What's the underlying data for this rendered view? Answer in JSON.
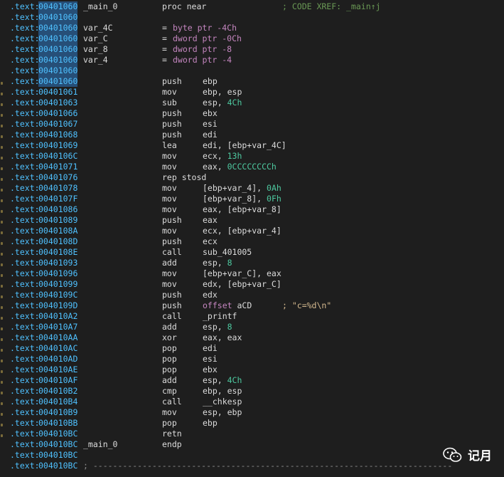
{
  "colors": {
    "background": "#1e1e1e",
    "address": "#4fc1ff",
    "number": "#4ec9a0",
    "keyword": "#c586c0",
    "comment": "#6a9955",
    "text": "#dcdcdc",
    "selection": "#264f78"
  },
  "lines": [
    {
      "addr": "00401060",
      "label": "_main_0",
      "mn": "proc near",
      "ops": [],
      "comment": "; CODE XREF: _main↑j",
      "hl": true
    },
    {
      "addr": "00401060",
      "hl": true
    },
    {
      "addr": "00401060",
      "label": "var_4C",
      "eq": "=",
      "ops": [
        {
          "t": "byte ptr -4Ch",
          "c": "kw"
        }
      ],
      "hl": true
    },
    {
      "addr": "00401060",
      "label": "var_C",
      "eq": "=",
      "ops": [
        {
          "t": "dword ptr -0Ch",
          "c": "kw"
        }
      ],
      "hl": true
    },
    {
      "addr": "00401060",
      "label": "var_8",
      "eq": "=",
      "ops": [
        {
          "t": "dword ptr -8",
          "c": "kw"
        }
      ],
      "hl": true
    },
    {
      "addr": "00401060",
      "label": "var_4",
      "eq": "=",
      "ops": [
        {
          "t": "dword ptr -4",
          "c": "kw"
        }
      ],
      "hl": true
    },
    {
      "addr": "00401060",
      "hl": true
    },
    {
      "addr": "00401060",
      "mn": "push",
      "ops": [
        {
          "t": "ebp",
          "c": "reg"
        }
      ],
      "hl": true,
      "gut": true
    },
    {
      "addr": "00401061",
      "mn": "mov",
      "ops": [
        {
          "t": "ebp, esp",
          "c": "reg"
        }
      ],
      "gut": true
    },
    {
      "addr": "00401063",
      "mn": "sub",
      "ops": [
        {
          "t": "esp, ",
          "c": "reg"
        },
        {
          "t": "4Ch",
          "c": "num"
        }
      ],
      "gut": true
    },
    {
      "addr": "00401066",
      "mn": "push",
      "ops": [
        {
          "t": "ebx",
          "c": "reg"
        }
      ],
      "gut": true
    },
    {
      "addr": "00401067",
      "mn": "push",
      "ops": [
        {
          "t": "esi",
          "c": "reg"
        }
      ],
      "gut": true
    },
    {
      "addr": "00401068",
      "mn": "push",
      "ops": [
        {
          "t": "edi",
          "c": "reg"
        }
      ],
      "gut": true
    },
    {
      "addr": "00401069",
      "mn": "lea",
      "ops": [
        {
          "t": "edi, [ebp+var_4C]",
          "c": "reg"
        }
      ],
      "gut": true
    },
    {
      "addr": "0040106C",
      "mn": "mov",
      "ops": [
        {
          "t": "ecx, ",
          "c": "reg"
        },
        {
          "t": "13h",
          "c": "num"
        }
      ],
      "gut": true
    },
    {
      "addr": "00401071",
      "mn": "mov",
      "ops": [
        {
          "t": "eax, ",
          "c": "reg"
        },
        {
          "t": "0CCCCCCCCh",
          "c": "num"
        }
      ],
      "gut": true
    },
    {
      "addr": "00401076",
      "mn": "rep stosd",
      "ops": [],
      "gut": true
    },
    {
      "addr": "00401078",
      "mn": "mov",
      "ops": [
        {
          "t": "[ebp+var_4], ",
          "c": "reg"
        },
        {
          "t": "0Ah",
          "c": "num"
        }
      ],
      "gut": true
    },
    {
      "addr": "0040107F",
      "mn": "mov",
      "ops": [
        {
          "t": "[ebp+var_8], ",
          "c": "reg"
        },
        {
          "t": "0Fh",
          "c": "num"
        }
      ],
      "gut": true
    },
    {
      "addr": "00401086",
      "mn": "mov",
      "ops": [
        {
          "t": "eax, [ebp+var_8]",
          "c": "reg"
        }
      ],
      "gut": true
    },
    {
      "addr": "00401089",
      "mn": "push",
      "ops": [
        {
          "t": "eax",
          "c": "reg"
        }
      ],
      "gut": true
    },
    {
      "addr": "0040108A",
      "mn": "mov",
      "ops": [
        {
          "t": "ecx, [ebp+var_4]",
          "c": "reg"
        }
      ],
      "gut": true
    },
    {
      "addr": "0040108D",
      "mn": "push",
      "ops": [
        {
          "t": "ecx",
          "c": "reg"
        }
      ],
      "gut": true
    },
    {
      "addr": "0040108E",
      "mn": "call",
      "ops": [
        {
          "t": "sub_401005",
          "c": "reg"
        }
      ],
      "gut": true
    },
    {
      "addr": "00401093",
      "mn": "add",
      "ops": [
        {
          "t": "esp, ",
          "c": "reg"
        },
        {
          "t": "8",
          "c": "num"
        }
      ],
      "gut": true
    },
    {
      "addr": "00401096",
      "mn": "mov",
      "ops": [
        {
          "t": "[ebp+var_C], eax",
          "c": "reg"
        }
      ],
      "gut": true
    },
    {
      "addr": "00401099",
      "mn": "mov",
      "ops": [
        {
          "t": "edx, [ebp+var_C]",
          "c": "reg"
        }
      ],
      "gut": true
    },
    {
      "addr": "0040109C",
      "mn": "push",
      "ops": [
        {
          "t": "edx",
          "c": "reg"
        }
      ],
      "gut": true
    },
    {
      "addr": "0040109D",
      "mn": "push",
      "ops": [
        {
          "t": "offset ",
          "c": "kw"
        },
        {
          "t": "aCD",
          "c": "reg"
        }
      ],
      "comment": "; \"c=%d\\n\"",
      "cmtLeft": 397,
      "gut": true
    },
    {
      "addr": "004010A2",
      "mn": "call",
      "ops": [
        {
          "t": "_printf",
          "c": "reg"
        }
      ],
      "gut": true
    },
    {
      "addr": "004010A7",
      "mn": "add",
      "ops": [
        {
          "t": "esp, ",
          "c": "reg"
        },
        {
          "t": "8",
          "c": "num"
        }
      ],
      "gut": true
    },
    {
      "addr": "004010AA",
      "mn": "xor",
      "ops": [
        {
          "t": "eax, eax",
          "c": "reg"
        }
      ],
      "gut": true
    },
    {
      "addr": "004010AC",
      "mn": "pop",
      "ops": [
        {
          "t": "edi",
          "c": "reg"
        }
      ],
      "gut": true
    },
    {
      "addr": "004010AD",
      "mn": "pop",
      "ops": [
        {
          "t": "esi",
          "c": "reg"
        }
      ],
      "gut": true
    },
    {
      "addr": "004010AE",
      "mn": "pop",
      "ops": [
        {
          "t": "ebx",
          "c": "reg"
        }
      ],
      "gut": true
    },
    {
      "addr": "004010AF",
      "mn": "add",
      "ops": [
        {
          "t": "esp, ",
          "c": "reg"
        },
        {
          "t": "4Ch",
          "c": "num"
        }
      ],
      "gut": true
    },
    {
      "addr": "004010B2",
      "mn": "cmp",
      "ops": [
        {
          "t": "ebp, esp",
          "c": "reg"
        }
      ],
      "gut": true
    },
    {
      "addr": "004010B4",
      "mn": "call",
      "ops": [
        {
          "t": "__chkesp",
          "c": "reg"
        }
      ],
      "gut": true
    },
    {
      "addr": "004010B9",
      "mn": "mov",
      "ops": [
        {
          "t": "esp, ebp",
          "c": "reg"
        }
      ],
      "gut": true
    },
    {
      "addr": "004010BB",
      "mn": "pop",
      "ops": [
        {
          "t": "ebp",
          "c": "reg"
        }
      ],
      "gut": true
    },
    {
      "addr": "004010BC",
      "mn": "retn",
      "ops": [],
      "gut": true
    },
    {
      "addr": "004010BC",
      "label": "_main_0",
      "mn": "endp",
      "ops": []
    },
    {
      "addr": "004010BC"
    },
    {
      "addr": "004010BC",
      "separator": "; -------------------------------------------------------------------------"
    }
  ],
  "segment_prefix": ".text:",
  "watermark": {
    "icon": "wechat-icon",
    "text": "记月"
  }
}
